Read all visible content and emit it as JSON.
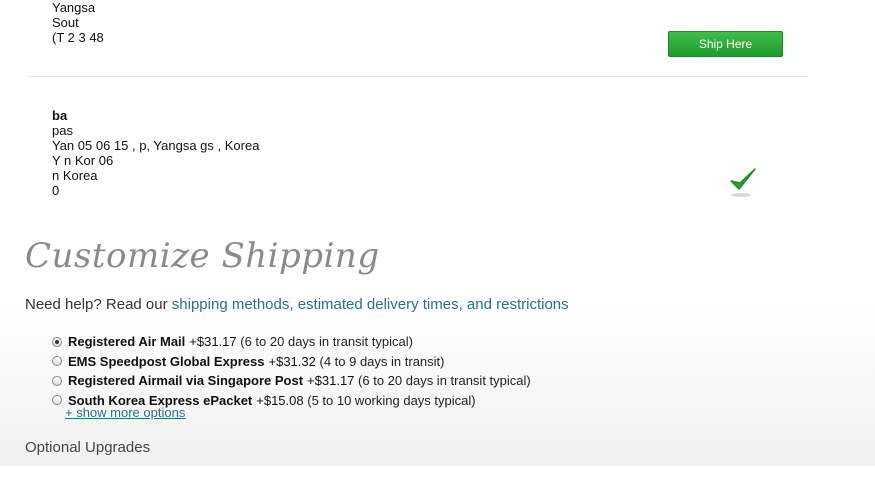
{
  "address_top": {
    "lines": [
      "Yangsa",
      "Sout",
      "(T   2      3  48"
    ]
  },
  "ship_here_button": "Ship Here",
  "address_selected": {
    "lines": [
      "ba",
      "  pas",
      "Yan           05  06 15         ,  p, Yangsa  gs  , Korea",
      "Y    n Kor    06",
      "   n Korea",
      "    0       "
    ]
  },
  "heading": "Customize Shipping",
  "help": {
    "prefix": "Need help? Read our ",
    "link": "shipping methods, estimated delivery times, and restrictions"
  },
  "shipping_options": [
    {
      "name": "Registered Air Mail",
      "price": "+$31.17",
      "detail": "(6 to 20 days in transit typical)",
      "selected": true
    },
    {
      "name": "EMS Speedpost Global Express",
      "price": "+$31.32",
      "detail": "(4 to 9 days in transit)",
      "selected": false
    },
    {
      "name": "Registered Airmail via Singapore Post",
      "price": "+$31.17",
      "detail": "(6 to 20 days in transit typical)",
      "selected": false
    },
    {
      "name": "South Korea Express ePacket",
      "price": "+$15.08",
      "detail": "(5 to 10 working days typical)",
      "selected": false
    }
  ],
  "show_more": "+ show more options",
  "optional_upgrades": "Optional Upgrades",
  "colors": {
    "button_green": "#2aa836",
    "link_blue": "#2a6f8f",
    "check_green": "#2fa334"
  }
}
